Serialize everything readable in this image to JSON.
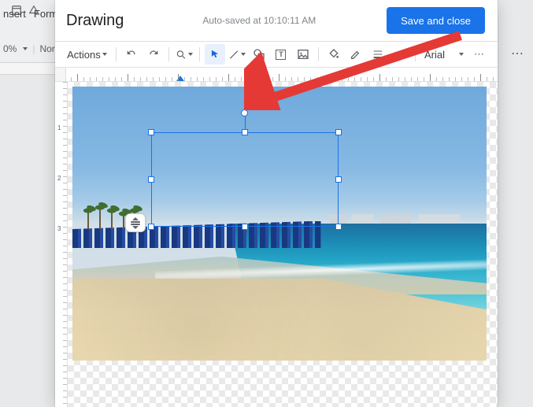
{
  "doc": {
    "menu_insert": "nsert",
    "menu_format": "Form",
    "zoom": "0%",
    "style": "Nor"
  },
  "dialog": {
    "title": "Drawing",
    "autosave": "Auto-saved at 10:10:11 AM",
    "save_button": "Save and close"
  },
  "toolbar": {
    "actions": "Actions",
    "font": "Arial"
  },
  "ruler": {
    "v1": "1",
    "v2": "2",
    "v3": "3"
  },
  "icons": {
    "select": "select-icon",
    "line": "line-icon",
    "shape": "shape-icon",
    "textbox": "text-box-icon",
    "image": "image-icon",
    "undo": "undo-icon",
    "redo": "redo-icon",
    "paint": "paint-format-icon",
    "zoom": "zoom-icon",
    "fill": "fill-color-icon",
    "border_color": "border-color-icon",
    "border_weight": "border-weight-icon",
    "border_dash": "border-dash-icon",
    "more": "more-icon"
  }
}
